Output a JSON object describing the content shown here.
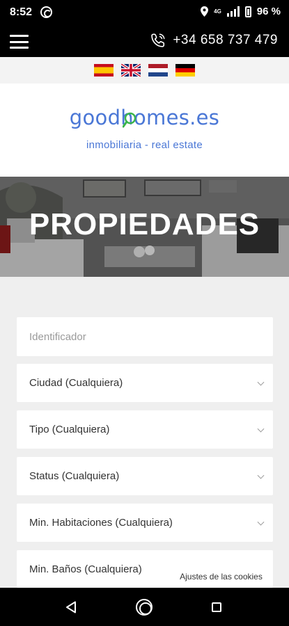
{
  "status_bar": {
    "time": "8:52",
    "network": "4G",
    "battery": "96 %"
  },
  "header": {
    "phone": "+34 658 737 479"
  },
  "languages": [
    {
      "name": "spain-flag-icon"
    },
    {
      "name": "uk-flag-icon"
    },
    {
      "name": "netherlands-flag-icon"
    },
    {
      "name": "germany-flag-icon"
    }
  ],
  "logo": {
    "name": "goodhomes.es",
    "tagline": "inmobiliaria - real estate"
  },
  "hero": {
    "title": "PROPIEDADES"
  },
  "form": {
    "identifier_placeholder": "Identificador",
    "city": "Ciudad (Cualquiera)",
    "type": "Tipo (Cualquiera)",
    "status": "Status (Cualquiera)",
    "min_rooms": "Min. Habitaciones (Cualquiera)",
    "min_baths": "Min. Baños (Cualquiera)"
  },
  "cookies": {
    "label": "Ajustes de las cookies"
  },
  "colors": {
    "brand": "#4a77d6",
    "lens": "#3bb54a",
    "form_bg": "#efefef"
  }
}
